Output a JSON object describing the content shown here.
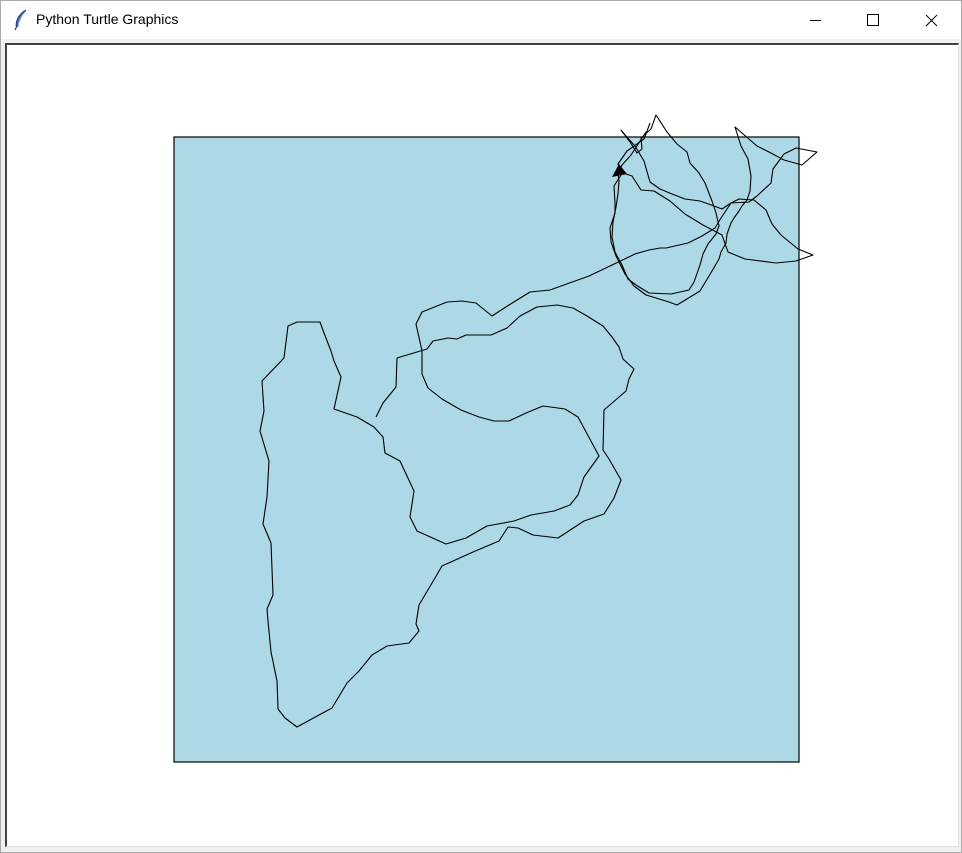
{
  "window": {
    "title": "Python Turtle Graphics",
    "app_icon": "feather-icon",
    "controls": {
      "minimize_icon": "minimize-icon",
      "maximize_icon": "maximize-icon",
      "close_icon": "close-icon"
    }
  },
  "canvas": {
    "background_color": "#ffffff",
    "square_fill_color": "#add8e6",
    "square_outline_color": "#000000",
    "pen_color": "#000000",
    "turtle_shape": "classic-arrow",
    "turtle_icon": "turtle-arrow-icon"
  }
}
